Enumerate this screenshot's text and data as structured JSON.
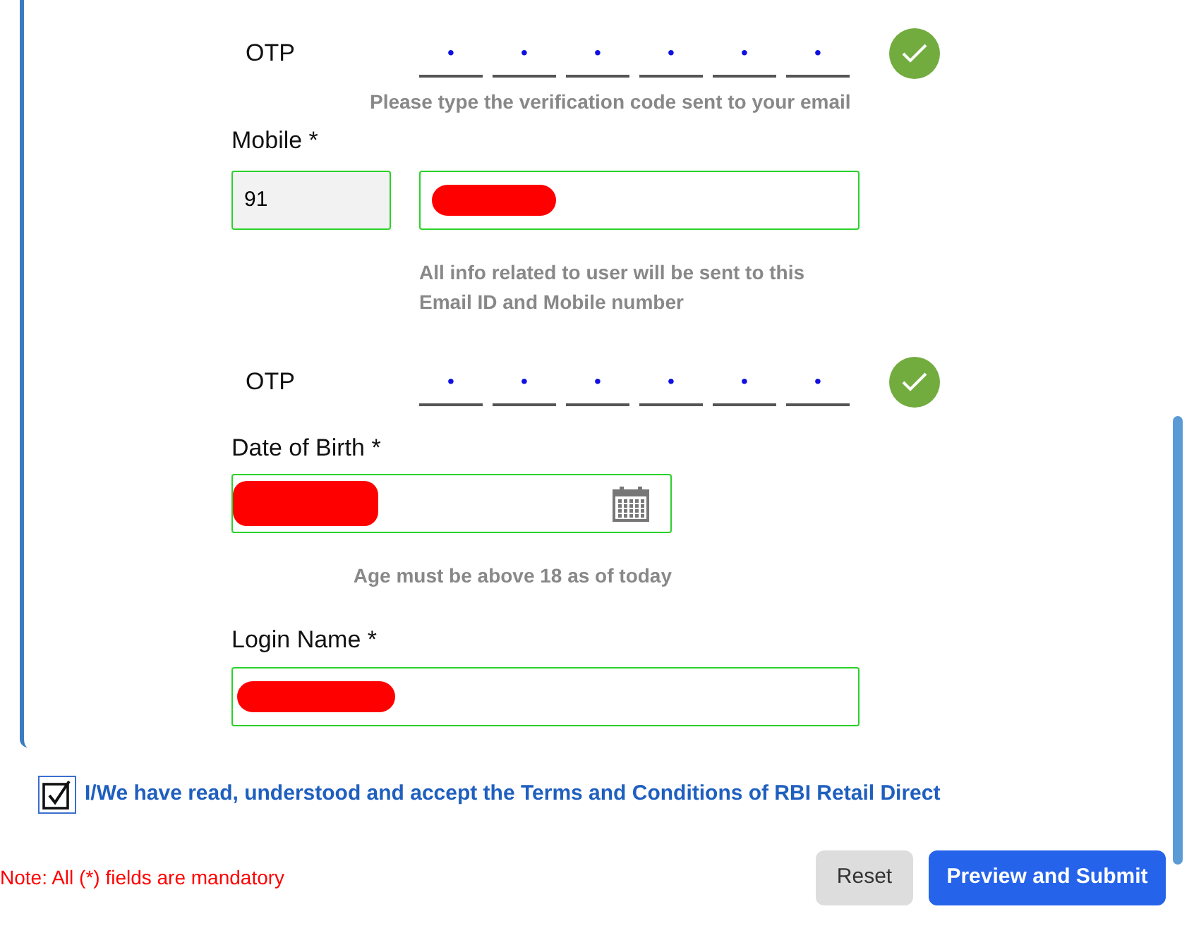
{
  "fields": [
    {
      "kind": "otp",
      "label": "OTP",
      "digits": [
        "•",
        "•",
        "•",
        "•",
        "•",
        "•"
      ],
      "verified": true,
      "hint": "Please type the verification code sent to your email"
    },
    {
      "kind": "phone",
      "label": "Mobile *",
      "code": "91",
      "valid": true,
      "redacted": true,
      "hint": "All info related to user will be sent to this Email ID and Mobile number"
    },
    {
      "kind": "otp",
      "label": "OTP",
      "digits": [
        "•",
        "•",
        "•",
        "•",
        "•",
        "•"
      ],
      "verified": true
    },
    {
      "kind": "date",
      "label": "Date of Birth *",
      "valid": true,
      "redacted": true,
      "hint": "Age must be above 18 as of today"
    },
    {
      "kind": "text",
      "label": "Login Name *",
      "valid": true,
      "redacted": true
    }
  ],
  "terms": {
    "checked": true,
    "text": "I/We have read, understood and accept the Terms and Conditions of RBI Retail Direct"
  },
  "note": "Note: All (*) fields are mandatory",
  "buttons": [
    {
      "label": "Reset",
      "kind": "secondary"
    },
    {
      "label": "Preview and Submit",
      "kind": "primary"
    }
  ]
}
